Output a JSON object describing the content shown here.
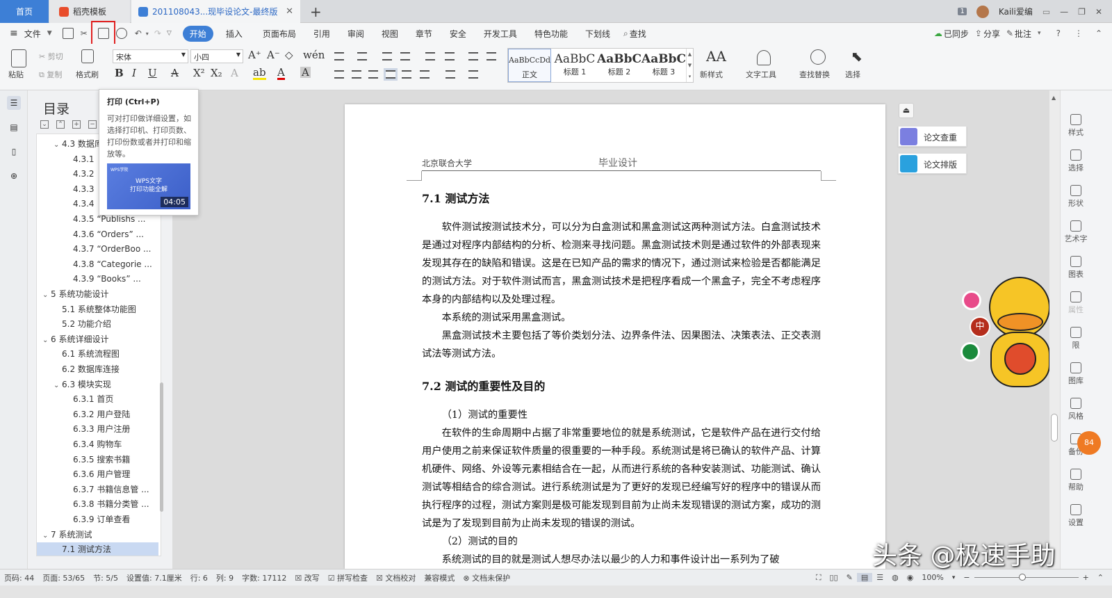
{
  "tabs": {
    "home": "首页",
    "daoke": "稻壳模板",
    "doc": "201108043...现毕设论文-最终版",
    "new": "+"
  },
  "titlebar": {
    "page_badge": "1",
    "user": "Kaili爱编"
  },
  "menu": {
    "file": "文件",
    "items": [
      "开始",
      "插入",
      "页面布局",
      "引用",
      "审阅",
      "视图",
      "章节",
      "安全",
      "开发工具",
      "特色功能",
      "下划线"
    ],
    "find": "查找",
    "synced": "已同步",
    "share": "分享",
    "comment": "批注"
  },
  "ribbon": {
    "paste": "粘贴",
    "cut": "剪切",
    "copy": "复制",
    "format_painter": "格式刷",
    "font_name": "宋体",
    "font_size": "小四",
    "styles": [
      {
        "sample": "AaBbCcDd",
        "label": "正文"
      },
      {
        "sample": "AaBbC",
        "label": "标题 1"
      },
      {
        "sample": "AaBbC",
        "label": "标题 2"
      },
      {
        "sample": "AaBbC",
        "label": "标题 3"
      }
    ],
    "new_style": "新样式",
    "text_tools": "文字工具",
    "find_replace": "查找替换",
    "select": "选择"
  },
  "tooltip": {
    "title": "打印 (Ctrl+P)",
    "desc": "可对打印做详细设置，如选择打印机、打印页数、打印份数或者并打印和缩放等。",
    "video_brand": "WPS学院",
    "video_title": "WPS文字",
    "video_subtitle": "打印功能全解",
    "video_time": "04:05"
  },
  "toc": {
    "title": "目录",
    "items": [
      {
        "level": 1,
        "label": "4.3 数据库",
        "tw": "v"
      },
      {
        "level": 2,
        "label": "4.3.1"
      },
      {
        "level": 2,
        "label": "4.3.2"
      },
      {
        "level": 2,
        "label": "4.3.3"
      },
      {
        "level": 2,
        "label": "4.3.4"
      },
      {
        "level": 2,
        "label": "4.3.5 “Publishs ..."
      },
      {
        "level": 2,
        "label": "4.3.6 “Orders” ..."
      },
      {
        "level": 2,
        "label": "4.3.7 “OrderBoo ..."
      },
      {
        "level": 2,
        "label": "4.3.8 “Categorie ..."
      },
      {
        "level": 2,
        "label": "4.3.9 “Books” ..."
      },
      {
        "level": 0,
        "label": "5  系统功能设计",
        "tw": "v"
      },
      {
        "level": 1,
        "label": "5.1 系统整体功能图"
      },
      {
        "level": 1,
        "label": "5.2 功能介绍"
      },
      {
        "level": 0,
        "label": "6  系统详细设计",
        "tw": "v"
      },
      {
        "level": 1,
        "label": "6.1 系统流程图"
      },
      {
        "level": 1,
        "label": "6.2 数据库连接"
      },
      {
        "level": 1,
        "label": "6.3  模块实现",
        "tw": "v"
      },
      {
        "level": 2,
        "label": "6.3.1 首页"
      },
      {
        "level": 2,
        "label": "6.3.2 用户登陆"
      },
      {
        "level": 2,
        "label": "6.3.3 用户注册"
      },
      {
        "level": 2,
        "label": "6.3.4 购物车"
      },
      {
        "level": 2,
        "label": "6.3.5 搜索书籍"
      },
      {
        "level": 2,
        "label": "6.3.6 用户管理"
      },
      {
        "level": 2,
        "label": "6.3.7 书籍信息管 ..."
      },
      {
        "level": 2,
        "label": "6.3.8 书籍分类管 ..."
      },
      {
        "level": 2,
        "label": "6.3.9  订单查看"
      },
      {
        "level": 0,
        "label": "7 系统测试",
        "tw": "v"
      },
      {
        "level": 1,
        "label": "7.1  测试方法",
        "selected": true
      }
    ]
  },
  "document": {
    "header_left": "北京联合大学",
    "header_center": "毕业设计",
    "h1": "7.1  测试方法",
    "p1": "软件测试按测试技术分，可以分为白盒测试和黑盒测试这两种测试方法。白盒测试技术是通过对程序内部结构的分析、检测来寻找问题。黑盒测试技术则是通过软件的外部表现来发现其存在的缺陷和错误。这是在已知产品的需求的情况下，通过测试来检验是否都能满足的测试方法。对于软件测试而言，黑盒测试技术是把程序看成一个黑盒子，完全不考虑程序本身的内部结构以及处理过程。",
    "p2": "本系统的测试采用黑盒测试。",
    "p3": "黑盒测试技术主要包括了等价类划分法、边界条件法、因果图法、决策表法、正交表测试法等测试方法。",
    "h2": "7.2 测试的重要性及目的",
    "p4": "（1）测试的重要性",
    "p5": "在软件的生命周期中占据了非常重要地位的就是系统测试，它是软件产品在进行交付给用户使用之前来保证软件质量的很重要的一种手段。系统测试是将已确认的软件产品、计算机硬件、网络、外设等元素相结合在一起，从而进行系统的各种安装测试、功能测试、确认测试等相结合的综合测试。进行系统测试是为了更好的发现已经编写好的程序中的错误从而执行程序的过程，测试方案则是极可能发现到目前为止尚未发现错误的测试方案，成功的测试是为了发现到目前为止尚未发现的错误的测试。",
    "p6": "（2）测试的目的",
    "p7": "系统测试的目的就是测试人想尽办法以最少的人力和事件设计出一系列为了破"
  },
  "side_panel": {
    "check": "论文查重",
    "layout": "论文排版"
  },
  "right_rail": [
    "样式",
    "选择",
    "形状",
    "艺术字",
    "图表",
    "属性",
    "限",
    "图库",
    "风格",
    "备份",
    "帮助",
    "设置"
  ],
  "badges": {
    "zh": "中",
    "count": "84"
  },
  "status": {
    "page_code": "页码: 44",
    "page": "页面: 53/65",
    "section": "节: 5/5",
    "setting": "设置值: 7.1厘米",
    "row": "行: 6",
    "col": "列: 9",
    "words": "字数: 17112",
    "revise": "改写",
    "spellcheck": "拼写检查",
    "proofread": "文档校对",
    "compat": "兼容模式",
    "unprotected": "文档未保护",
    "zoom": "100%"
  },
  "watermark": "头条 @极速手助",
  "colors": {
    "accent": "#3d7fd6",
    "highlight": "#e02020"
  }
}
